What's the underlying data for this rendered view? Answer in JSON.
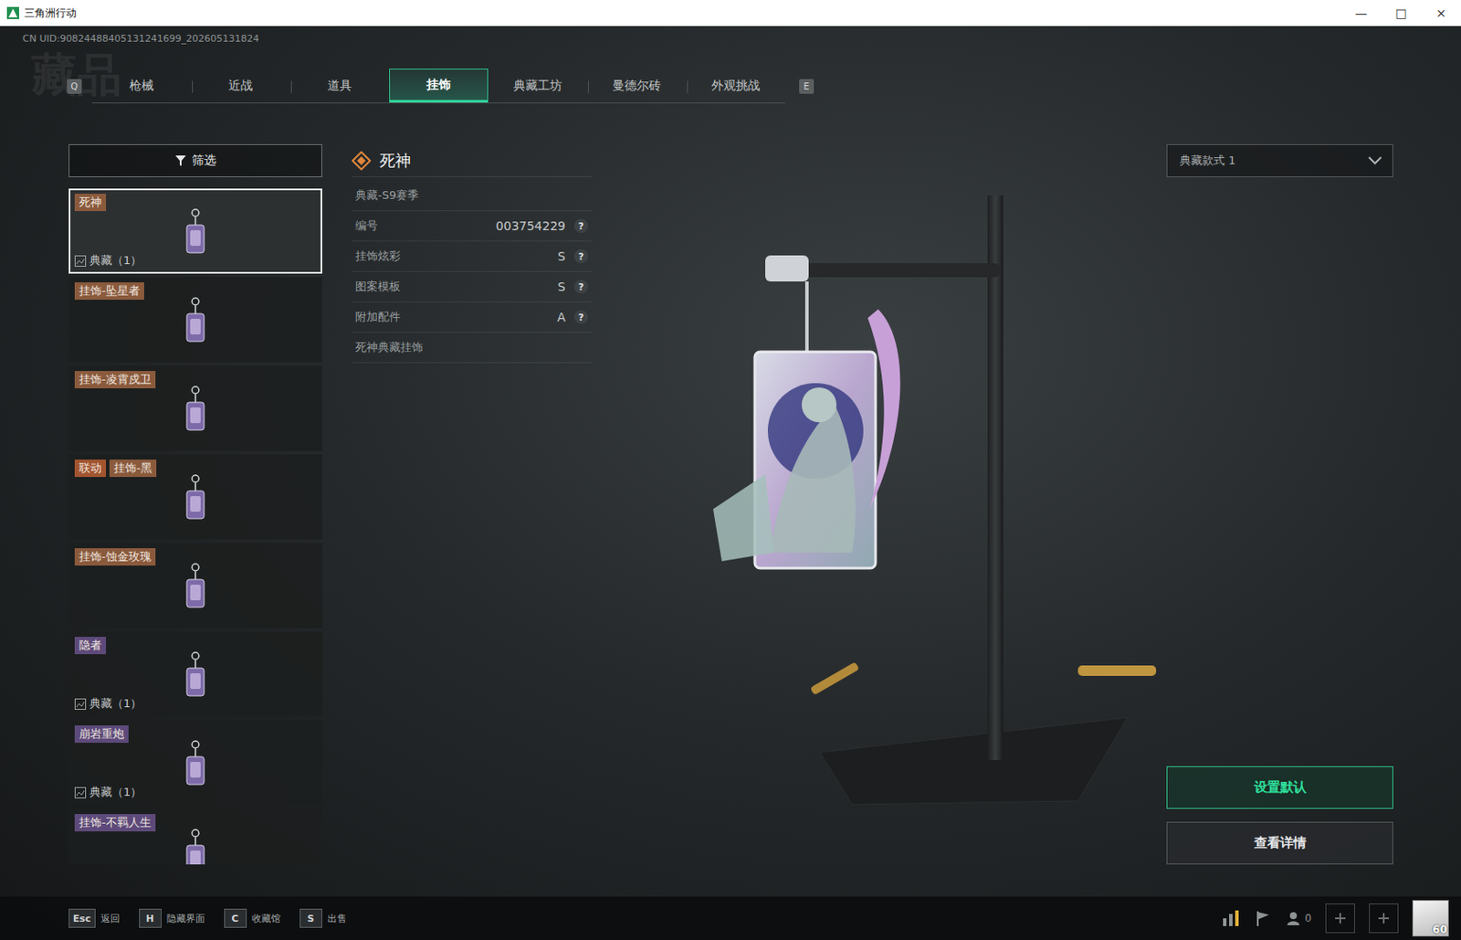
{
  "window": {
    "title": "三角洲行动",
    "controls": [
      "—",
      "□",
      "×"
    ]
  },
  "uid": "CN UID:90824488405131241699_202605131824",
  "page_title": "藏品",
  "tabs": {
    "prev_key": "Q",
    "next_key": "E",
    "items": [
      {
        "label": "枪械",
        "selected": false
      },
      {
        "label": "近战",
        "selected": false
      },
      {
        "label": "道具",
        "selected": false
      },
      {
        "label": "挂饰",
        "selected": true
      },
      {
        "label": "典藏工坊",
        "selected": false
      },
      {
        "label": "曼德尔砖",
        "selected": false
      },
      {
        "label": "外观挑战",
        "selected": false
      }
    ]
  },
  "filter": {
    "label": "筛选"
  },
  "items": [
    {
      "name": "死神",
      "color": "#8a5a3c",
      "selected": true,
      "collection": "典藏（1）"
    },
    {
      "name": "挂饰-坠星者",
      "color": "#8a5a3c",
      "selected": false
    },
    {
      "name": "挂饰-凌霄戍卫",
      "color": "#8a5a3c",
      "selected": false
    },
    {
      "name": "挂饰-黑",
      "tag": "联动",
      "color": "#8a5a3c",
      "selected": false
    },
    {
      "name": "挂饰-蚀金玫瑰",
      "color": "#8a5a3c",
      "selected": false
    },
    {
      "name": "隐者",
      "color": "#5d4a7a",
      "selected": false,
      "collection": "典藏（1）"
    },
    {
      "name": "崩岩重炮",
      "color": "#5d4a7a",
      "selected": false,
      "collection": "典藏（1）"
    },
    {
      "name": "挂饰-不羁人生",
      "color": "#5d4a7a",
      "selected": false
    }
  ],
  "detail": {
    "title": "死神",
    "season": "典藏-S9赛季",
    "rows": [
      {
        "label": "编号",
        "value": "003754229",
        "help": "?"
      },
      {
        "label": "挂饰炫彩",
        "value": "S",
        "help": "?"
      },
      {
        "label": "图案模板",
        "value": "S",
        "help": "?"
      },
      {
        "label": "附加配件",
        "value": "A",
        "help": "?"
      }
    ],
    "description": "死神典藏挂饰"
  },
  "style_select": {
    "value": "典藏款式 1"
  },
  "buttons": [
    {
      "label": "设置默认",
      "primary": true
    },
    {
      "label": "查看详情",
      "primary": false
    }
  ],
  "hints": [
    {
      "key": "Esc",
      "label": "返回"
    },
    {
      "key": "H",
      "label": "隐藏界面"
    },
    {
      "key": "C",
      "label": "收藏馆"
    },
    {
      "key": "S",
      "label": "出售"
    }
  ],
  "status": {
    "friends": "0",
    "level": "60"
  }
}
